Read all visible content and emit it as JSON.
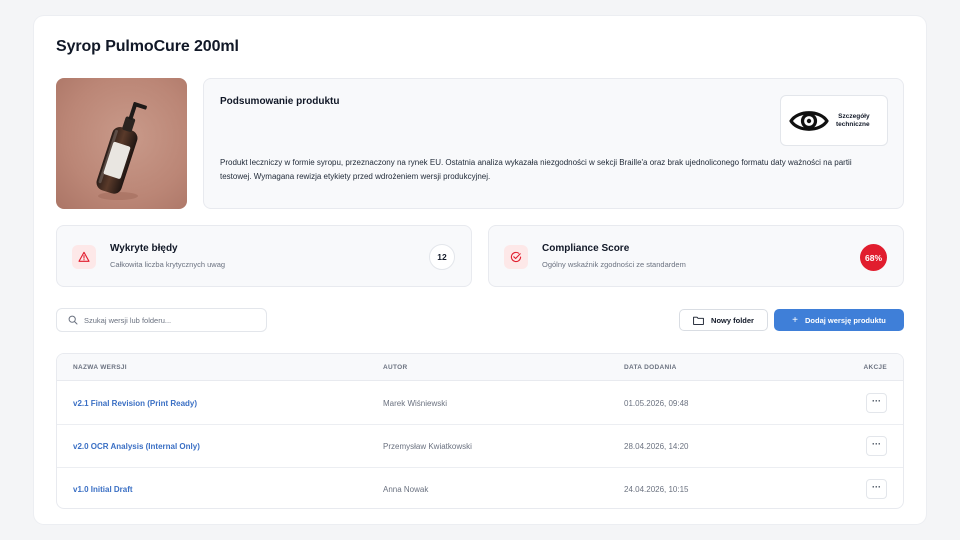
{
  "page": {
    "title": "Syrop PulmoCure 200ml"
  },
  "summary": {
    "title": "Podsumowanie produktu",
    "description": "Produkt leczniczy w formie syropu, przeznaczony na rynek EU. Ostatnia analiza wykazała niezgodności w sekcji Braille'a oraz brak ujednoliconego formatu daty ważności na partii testowej. Wymagana rewizja etykiety przed wdrożeniem wersji produkcyjnej.",
    "tech_button": {
      "line1": "Szczegóły",
      "line2": "techniczne",
      "icon": "eye-icon"
    }
  },
  "stats": {
    "errors": {
      "title": "Wykryte błędy",
      "subtitle": "Całkowita liczba krytycznych uwag",
      "count": "12",
      "icon": "warning-triangle-icon"
    },
    "score": {
      "title": "Compliance Score",
      "subtitle": "Ogólny wskaźnik zgodności ze standardem",
      "value": "68%",
      "icon": "check-circle-icon"
    }
  },
  "toolbar": {
    "search_placeholder": "Szukaj wersji lub folderu...",
    "new_folder_label": "Nowy folder",
    "add_version_label": "Dodaj wersję produktu"
  },
  "table": {
    "headers": {
      "name": "NAZWA WERSJI",
      "author": "AUTOR",
      "date": "DATA DODANIA",
      "actions": "AKCJE"
    },
    "rows": [
      {
        "name": "v2.1 Final Revision (Print Ready)",
        "author": "Marek Wiśniewski",
        "date": "01.05.2026, 09:48",
        "action": "···"
      },
      {
        "name": "v2.0 OCR Analysis (Internal Only)",
        "author": "Przemysław Kwiatkowski",
        "date": "28.04.2026, 14:20",
        "action": "···"
      },
      {
        "name": "v1.0 Initial Draft",
        "author": "Anna Nowak",
        "date": "24.04.2026, 10:15",
        "action": "···"
      }
    ]
  },
  "colors": {
    "accent": "#3f7fd8",
    "danger": "#e11d2e",
    "link": "#3a6fc4"
  }
}
